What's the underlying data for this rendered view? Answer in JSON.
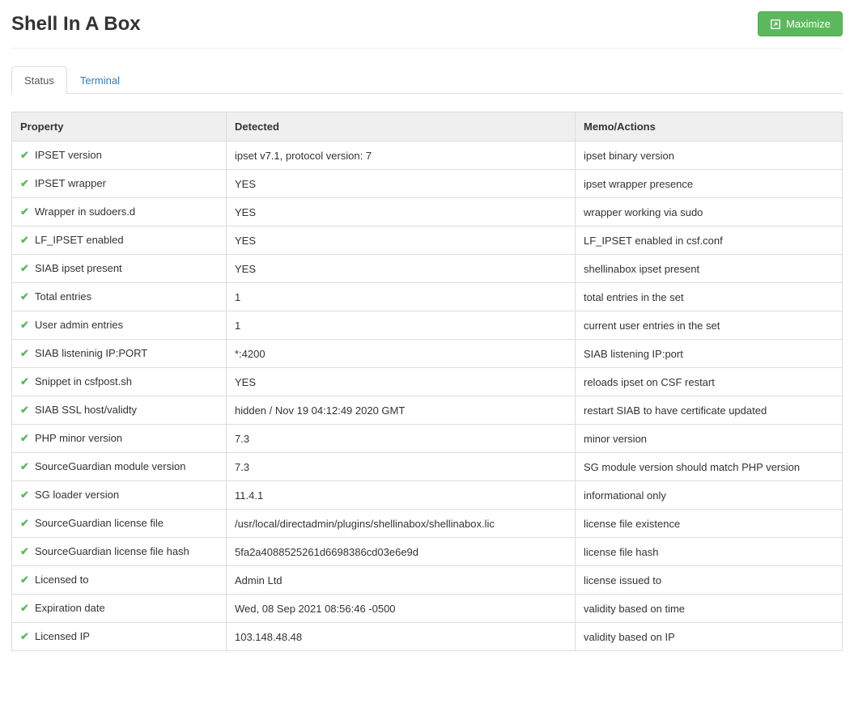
{
  "header": {
    "title": "Shell In A Box",
    "maximize_label": "Maximize"
  },
  "tabs": [
    {
      "label": "Status",
      "active": true
    },
    {
      "label": "Terminal",
      "active": false
    }
  ],
  "table": {
    "headers": {
      "property": "Property",
      "detected": "Detected",
      "memo": "Memo/Actions"
    },
    "rows": [
      {
        "ok": true,
        "property": "IPSET version",
        "detected": "ipset v7.1, protocol version: 7",
        "memo": "ipset binary version"
      },
      {
        "ok": true,
        "property": "IPSET wrapper",
        "detected": "YES",
        "memo": "ipset wrapper presence"
      },
      {
        "ok": true,
        "property": "Wrapper in sudoers.d",
        "detected": "YES",
        "memo": "wrapper working via sudo"
      },
      {
        "ok": true,
        "property": "LF_IPSET enabled",
        "detected": "YES",
        "memo": "LF_IPSET enabled in csf.conf"
      },
      {
        "ok": true,
        "property": "SIAB ipset present",
        "detected": "YES",
        "memo": "shellinabox ipset present"
      },
      {
        "ok": true,
        "property": "Total entries",
        "detected": "1",
        "memo": "total entries in the set"
      },
      {
        "ok": true,
        "property": "User admin entries",
        "detected": "1",
        "memo": "current user entries in the set"
      },
      {
        "ok": true,
        "property": "SIAB listeninig IP:PORT",
        "detected": "*:4200",
        "memo": "SIAB listening IP:port"
      },
      {
        "ok": true,
        "property": "Snippet in csfpost.sh",
        "detected": "YES",
        "memo": "reloads ipset on CSF restart"
      },
      {
        "ok": true,
        "property": "SIAB SSL host/validty",
        "detected": "hidden / Nov 19 04:12:49 2020 GMT",
        "memo": "restart SIAB to have certificate updated"
      },
      {
        "ok": true,
        "property": "PHP minor version",
        "detected": "7.3",
        "memo": "minor version"
      },
      {
        "ok": true,
        "property": "SourceGuardian module version",
        "detected": "7.3",
        "memo": "SG module version should match PHP version"
      },
      {
        "ok": true,
        "property": "SG loader version",
        "detected": "11.4.1",
        "memo": "informational only"
      },
      {
        "ok": true,
        "property": "SourceGuardian license file",
        "detected": "/usr/local/directadmin/plugins/shellinabox/shellinabox.lic",
        "memo": "license file existence"
      },
      {
        "ok": true,
        "property": "SourceGuardian license file hash",
        "detected": "5fa2a4088525261d6698386cd03e6e9d",
        "memo": "license file hash"
      },
      {
        "ok": true,
        "property": "Licensed to",
        "detected": "Admin Ltd",
        "memo": "license issued to"
      },
      {
        "ok": true,
        "property": "Expiration date",
        "detected": "Wed, 08 Sep 2021 08:56:46 -0500",
        "memo": "validity based on time"
      },
      {
        "ok": true,
        "property": "Licensed IP",
        "detected": "103.148.48.48",
        "memo": "validity based on IP"
      }
    ]
  }
}
